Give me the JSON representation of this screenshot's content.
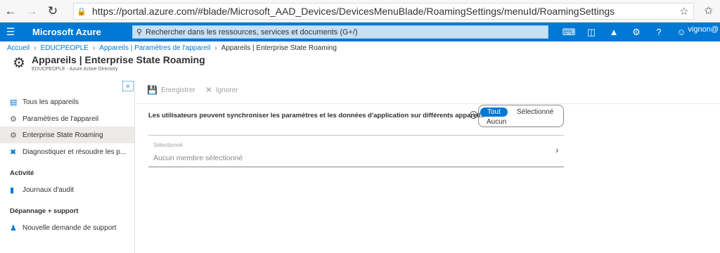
{
  "browser": {
    "url": "https://portal.azure.com/#blade/Microsoft_AAD_Devices/DevicesMenuBlade/RoamingSettings/menuId/RoamingSettings"
  },
  "header": {
    "brand": "Microsoft Azure",
    "search_placeholder": "Rechercher dans les ressources, services et documents (G+/)",
    "user": "vignon@"
  },
  "breadcrumb": [
    "Accueil",
    "EDUCPEOPLE",
    "Appareils | Paramètres de l'appareil",
    "Appareils | Enterprise State Roaming"
  ],
  "page": {
    "title": "Appareils | Enterprise State Roaming",
    "subtitle": "EDUCPEOPLE - Azure Active Directory"
  },
  "sidebar": {
    "collapse": "«",
    "items": [
      {
        "label": "Tous les appareils",
        "icon": "devices-icon"
      },
      {
        "label": "Paramètres de l'appareil",
        "icon": "settings-icon"
      },
      {
        "label": "Enterprise State Roaming",
        "icon": "gear-icon",
        "active": true
      },
      {
        "label": "Diagnostiquer et résoudre les p...",
        "icon": "wrench-icon"
      }
    ],
    "section_activity": "Activité",
    "activity_items": [
      {
        "label": "Journaux d'audit",
        "icon": "log-icon"
      }
    ],
    "section_support": "Dépannage + support",
    "support_items": [
      {
        "label": "Nouvelle demande de support",
        "icon": "support-icon"
      }
    ]
  },
  "toolbar": {
    "save": "Enregistrer",
    "discard": "Ignorer"
  },
  "setting": {
    "label": "Les utilisateurs peuvent synchroniser les paramètres et les données d'application sur différents appareils",
    "options": [
      "Tout",
      "Sélectionné",
      "Aucun"
    ],
    "selected": "Tout",
    "field_label": "Sélectionné",
    "field_value": "Aucun membre sélectionné"
  },
  "colors": {
    "accent": "#0078d4",
    "search_bg": "#c7e0f4"
  }
}
